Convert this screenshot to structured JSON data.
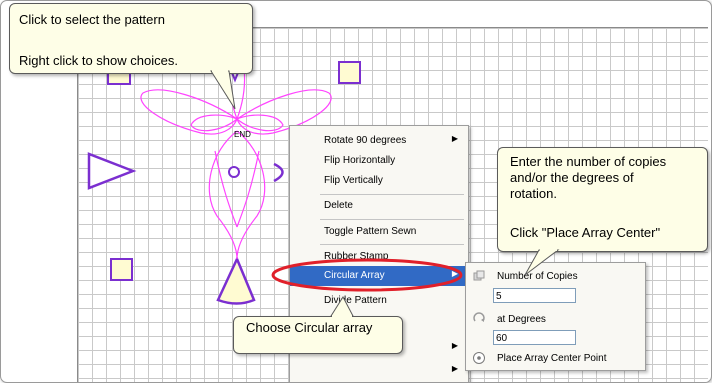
{
  "callouts": {
    "select": {
      "line1": "Click to select the pattern",
      "line2": "Right click to show choices."
    },
    "copies": {
      "line1": "Enter the number of copies",
      "line2": "and/or the degrees of",
      "line3": "rotation.",
      "line4": "Click \"Place Array Center\""
    },
    "circular": {
      "text": "Choose Circular array"
    }
  },
  "canvas": {
    "end_label": "END"
  },
  "context_menu": {
    "items": [
      {
        "label": "Rotate 90 degrees",
        "submenu": true
      },
      {
        "label": "Flip Horizontally",
        "submenu": false
      },
      {
        "label": "Flip Vertically",
        "submenu": false
      },
      {
        "label": "Delete",
        "submenu": false
      },
      {
        "label": "Toggle Pattern Sewn",
        "submenu": false
      },
      {
        "label": "Rubber Stamp",
        "submenu": false
      },
      {
        "label": "Circular Array",
        "submenu": true,
        "highlighted": true
      },
      {
        "label": "Divide Pattern",
        "submenu": false
      },
      {
        "label": "",
        "submenu": true
      },
      {
        "label": "",
        "submenu": true
      }
    ]
  },
  "circular_array_submenu": {
    "copies_label": "Number of Copies",
    "copies_value": "5",
    "degrees_label": "at Degrees",
    "degrees_value": "60",
    "center_label": "Place Array Center Point"
  },
  "colors": {
    "pattern": "#ff44ff",
    "shapes": "#7b2fd0",
    "square_fill": "#fffbd2",
    "highlight_oval": "#e0202a",
    "menu_highlight": "#316ac5"
  }
}
